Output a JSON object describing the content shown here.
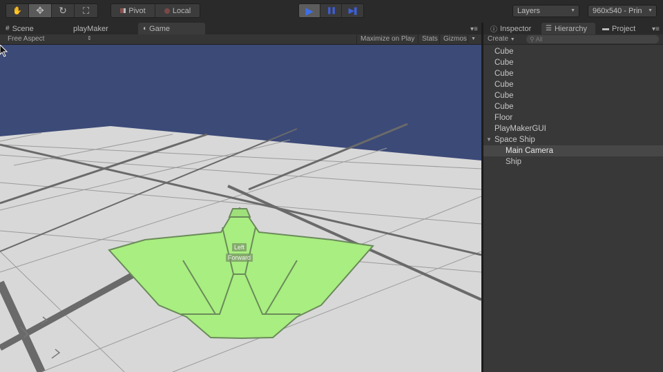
{
  "toolbar": {
    "transform_tools": [
      {
        "name": "hand-tool",
        "icon": "hand-icon",
        "glyph": "✋",
        "active": false
      },
      {
        "name": "move-tool",
        "icon": "move-icon",
        "glyph": "✥",
        "active": true
      },
      {
        "name": "rotate-tool",
        "icon": "rotate-icon",
        "glyph": "↻",
        "active": false
      },
      {
        "name": "scale-tool",
        "icon": "scale-icon",
        "glyph": "⛶",
        "active": false
      }
    ],
    "pivot_label": "Pivot",
    "local_label": "Local",
    "play_controls": {
      "play_glyph": "▶",
      "pause_glyph": "❚❚",
      "step_glyph": "▶❚"
    },
    "accent_color": "#3d6fe8",
    "layers_label": "Layers",
    "layout_label": "960x540 - Prin"
  },
  "tabs": {
    "scene": "Scene",
    "playmaker": "playMaker",
    "game": "Game",
    "inspector": "Inspector",
    "hierarchy": "Hierarchy",
    "project": "Project"
  },
  "game_view": {
    "aspect": "Free Aspect",
    "maximize_on_play": "Maximize on Play",
    "stats": "Stats",
    "gizmos": "Gizmos",
    "hud_left": "Left",
    "hud_forward": "Forward",
    "sky_color": "#3c4a78",
    "ship_color": "#a8ee80"
  },
  "hierarchy": {
    "create_label": "Create",
    "search_placeholder": "All",
    "items": [
      {
        "label": "Cube",
        "level": 0
      },
      {
        "label": "Cube",
        "level": 0
      },
      {
        "label": "Cube",
        "level": 0
      },
      {
        "label": "Cube",
        "level": 0
      },
      {
        "label": "Cube",
        "level": 0
      },
      {
        "label": "Cube",
        "level": 0
      },
      {
        "label": "Floor",
        "level": 0
      },
      {
        "label": "PlayMakerGUI",
        "level": 0
      },
      {
        "label": "Space Ship",
        "level": 0,
        "expanded": true
      },
      {
        "label": "Main Camera",
        "level": 1,
        "selected": true
      },
      {
        "label": "Ship",
        "level": 1
      }
    ]
  }
}
